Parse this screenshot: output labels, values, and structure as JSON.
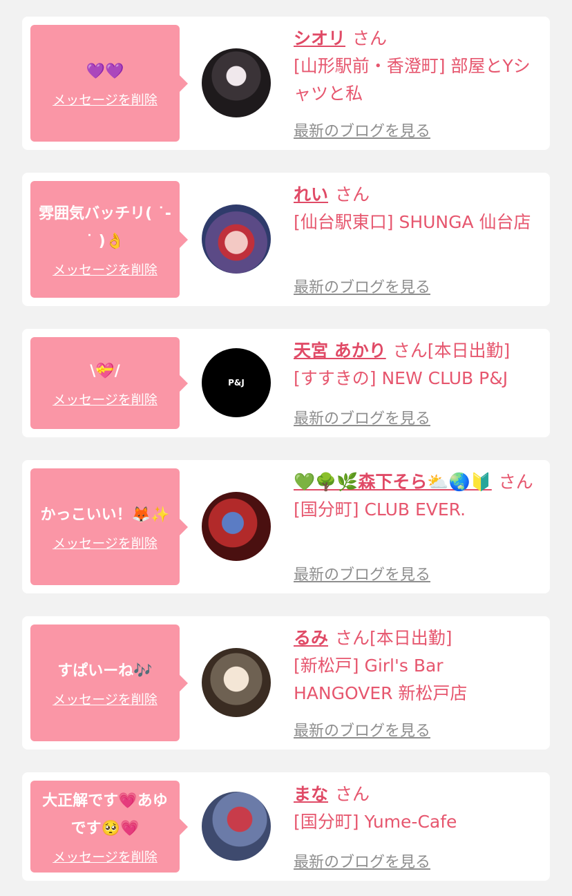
{
  "messages": [
    {
      "text": "💜💜",
      "delete_label": "メッセージを削除",
      "name": "シオリ",
      "honorific": "さん",
      "shop": "[山形駅前・香澄町] 部屋とYシャツと私",
      "blog_label": "最新のブログを見る"
    },
    {
      "text": "雰囲気バッチリ( ˙-˙ )👌",
      "delete_label": "メッセージを削除",
      "name": "れい",
      "honorific": "さん",
      "shop": "[仙台駅東口] SHUNGA 仙台店",
      "blog_label": "最新のブログを見る"
    },
    {
      "text": "\\💝/",
      "delete_label": "メッセージを削除",
      "name": "天宮 あかり",
      "honorific": "さん[本日出勤]",
      "shop": "[すすきの] NEW CLUB P&J",
      "blog_label": "最新のブログを見る",
      "avatar_text": "P&J"
    },
    {
      "text": "かっこいい！🦊✨",
      "delete_label": "メッセージを削除",
      "name": "💚🌳🌿森下そら⛅🌏🔰",
      "honorific": "さん",
      "shop": "[国分町] CLUB EVER.",
      "blog_label": "最新のブログを見る"
    },
    {
      "text": "すぱいーね🎶",
      "delete_label": "メッセージを削除",
      "name": "るみ",
      "honorific": "さん[本日出勤]",
      "shop": "[新松戸] Girl's Bar HANGOVER 新松戸店",
      "blog_label": "最新のブログを見る"
    },
    {
      "text": "大正解です💗あゆです🥺💗",
      "delete_label": "メッセージを削除",
      "name": "まな",
      "honorific": "さん",
      "shop": "[国分町] Yume-Cafe",
      "blog_label": "最新のブログを見る"
    }
  ]
}
